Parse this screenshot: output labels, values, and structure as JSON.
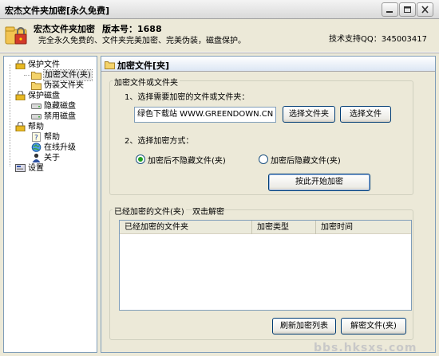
{
  "window": {
    "title": "宏杰文件夹加密[永久免费]"
  },
  "header": {
    "app_name": "宏杰文件夹加密",
    "version": "版本号：1688",
    "slogan": "完全永久免费的、文件夹完美加密、完美伪装，磁盘保护。",
    "support": "技术支持QQ：345003417"
  },
  "sidebar": {
    "items": [
      {
        "label": "保护文件",
        "icon": "lock-icon"
      },
      {
        "label": "加密文件(夹)",
        "icon": "folder-icon"
      },
      {
        "label": "伪装文件夹",
        "icon": "folder-icon"
      },
      {
        "label": "保护磁盘",
        "icon": "lock-icon"
      },
      {
        "label": "隐藏磁盘",
        "icon": "drive-icon"
      },
      {
        "label": "禁用磁盘",
        "icon": "drive-icon"
      },
      {
        "label": "帮助",
        "icon": "lock-icon"
      },
      {
        "label": "帮助",
        "icon": "help-icon"
      },
      {
        "label": "在线升级",
        "icon": "globe-icon"
      },
      {
        "label": "关于",
        "icon": "person-icon"
      },
      {
        "label": "设置",
        "icon": "settings-icon"
      }
    ]
  },
  "main": {
    "title": "加密文件[夹]",
    "encrypt_group": {
      "title": "加密文件或文件夹",
      "step1": "1、选择需要加密的文件或文件夹：",
      "path_value": "绿色下载站 WWW.GREENDOWN.CN",
      "select_folder": "选择文件夹",
      "select_file": "选择文件",
      "step2": "2、选择加密方式：",
      "option_no_hide": "加密后不隐藏文件(夹)",
      "option_hide": "加密后隐藏文件(夹)",
      "start_button": "按此开始加密"
    },
    "encrypted_group": {
      "title": "已经加密的文件(夹)",
      "hint": "双击解密",
      "columns": [
        "已经加密的文件夹",
        "加密类型",
        "加密时间"
      ],
      "refresh_button": "刷新加密列表",
      "decrypt_button": "解密文件(夹)"
    }
  },
  "watermark": "bbs.hksxs.com",
  "colors": {
    "accent": "#21A121",
    "border": "#7F9DB9",
    "face": "#ECE9D8"
  }
}
